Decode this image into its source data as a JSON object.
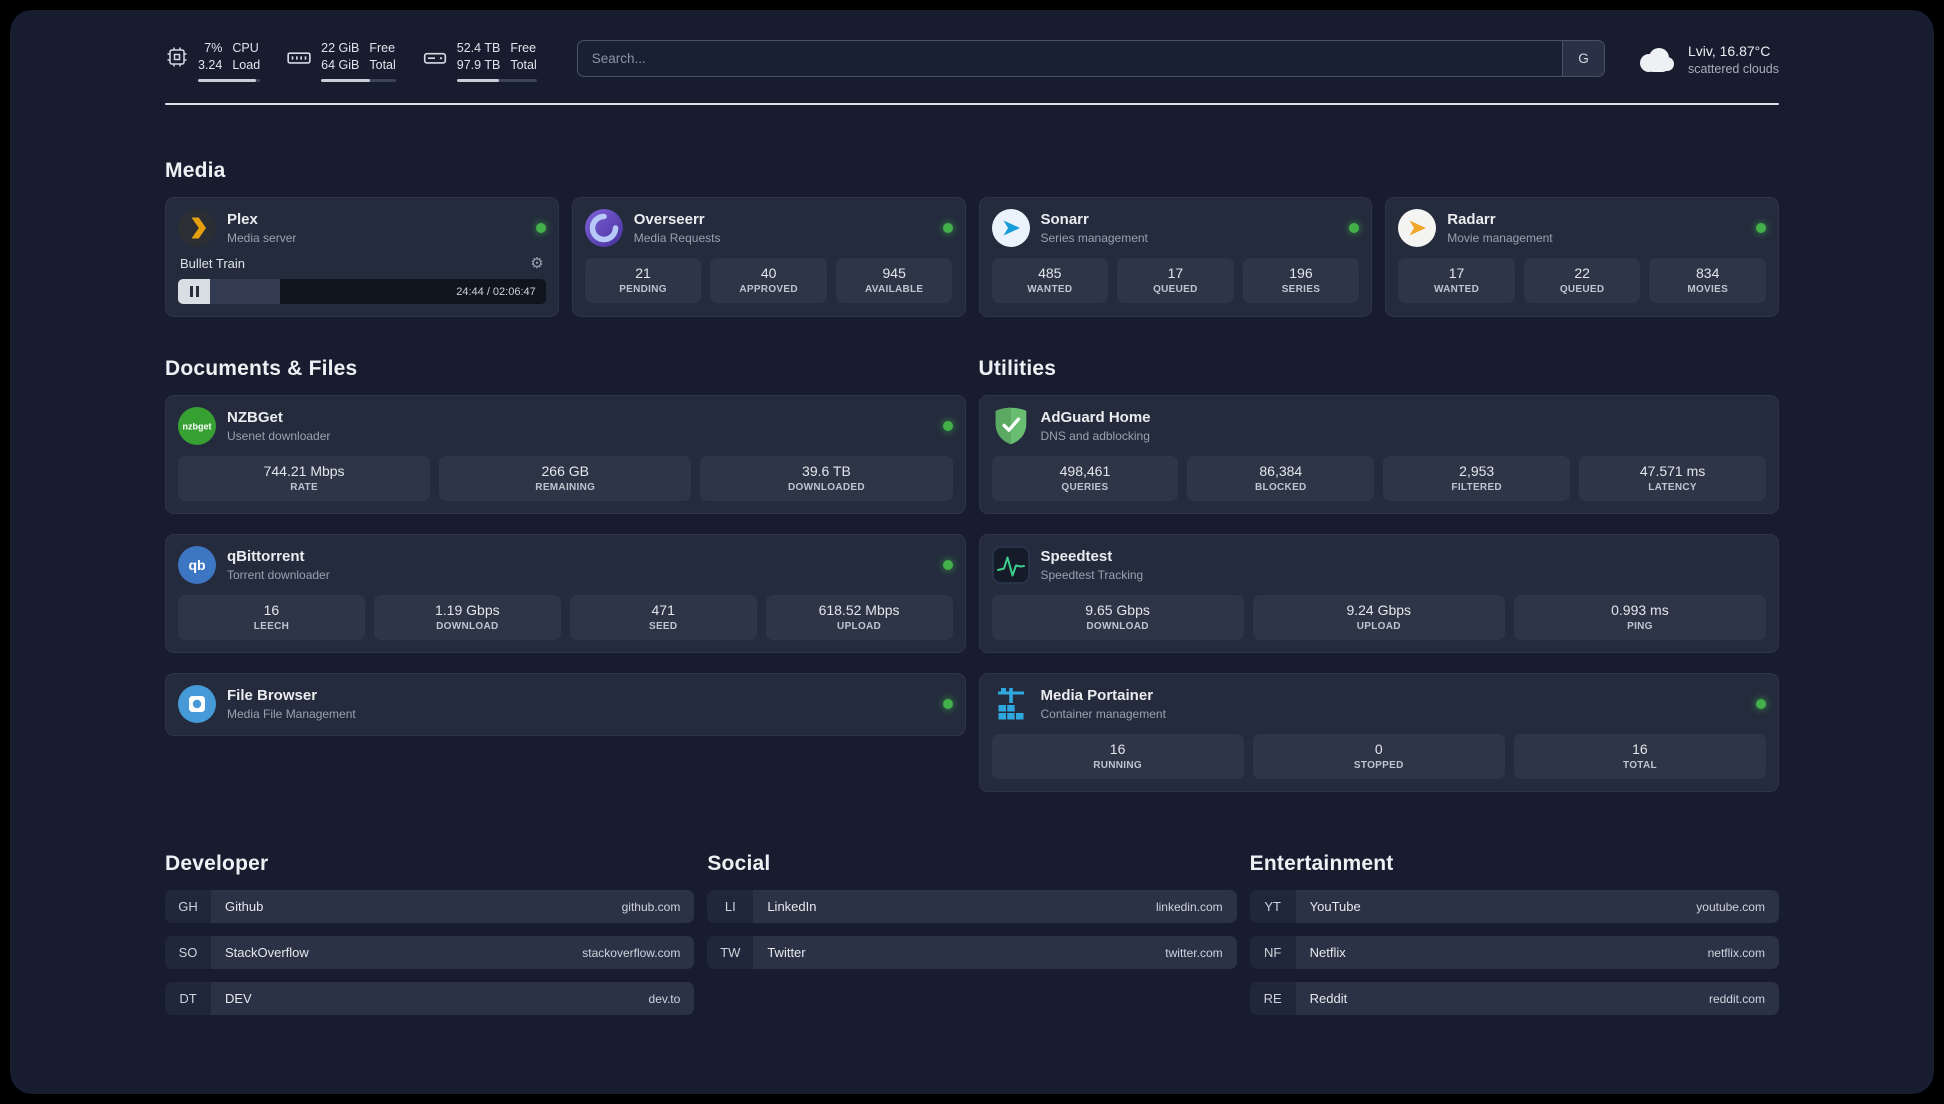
{
  "colors": {
    "status_green": "#43b04a",
    "page_background": "#171d2f",
    "card_background": "#242b3d",
    "stat_background": "#2e3547",
    "plex_gold": "#e5a00d",
    "sonarr_blue": "#159ddb",
    "radarr_amber": "#f0a72c",
    "adguard_green": "#68bd71",
    "portainer_blue": "#2fa8e0",
    "speedtest_line_green": "#3ecf8e"
  },
  "topbar": {
    "cpu": {
      "value_top": "7%",
      "value_bottom": "3.24",
      "label_top": "CPU",
      "label_bottom": "Load",
      "bar_percent": 93
    },
    "ram": {
      "value_top": "22 GiB",
      "value_bottom": "64 GiB",
      "label_top": "Free",
      "label_bottom": "Total",
      "bar_percent": 66
    },
    "disk": {
      "value_top": "52.4 TB",
      "value_bottom": "97.9 TB",
      "label_top": "Free",
      "label_bottom": "Total",
      "bar_percent": 53
    },
    "search": {
      "placeholder": "Search...",
      "engine_button": "G"
    },
    "weather": {
      "location": "Lviv, 16.87°C",
      "condition": "scattered clouds"
    }
  },
  "media": {
    "title": "Media",
    "plex": {
      "name": "Plex",
      "subtitle": "Media server",
      "now_playing": "Bullet Train",
      "time": "24:44 / 02:06:47",
      "progress_percent": 19
    },
    "overseerr": {
      "name": "Overseerr",
      "subtitle": "Media Requests",
      "stats": [
        {
          "value": "21",
          "label": "PENDING"
        },
        {
          "value": "40",
          "label": "APPROVED"
        },
        {
          "value": "945",
          "label": "AVAILABLE"
        }
      ]
    },
    "sonarr": {
      "name": "Sonarr",
      "subtitle": "Series management",
      "stats": [
        {
          "value": "485",
          "label": "WANTED"
        },
        {
          "value": "17",
          "label": "QUEUED"
        },
        {
          "value": "196",
          "label": "SERIES"
        }
      ]
    },
    "radarr": {
      "name": "Radarr",
      "subtitle": "Movie management",
      "stats": [
        {
          "value": "17",
          "label": "WANTED"
        },
        {
          "value": "22",
          "label": "QUEUED"
        },
        {
          "value": "834",
          "label": "MOVIES"
        }
      ]
    }
  },
  "documents": {
    "title": "Documents & Files",
    "nzbget": {
      "name": "NZBGet",
      "subtitle": "Usenet downloader",
      "stats": [
        {
          "value": "744.21 Mbps",
          "label": "RATE"
        },
        {
          "value": "266 GB",
          "label": "REMAINING"
        },
        {
          "value": "39.6 TB",
          "label": "DOWNLOADED"
        }
      ]
    },
    "qbittorrent": {
      "name": "qBittorrent",
      "subtitle": "Torrent downloader",
      "stats": [
        {
          "value": "16",
          "label": "LEECH"
        },
        {
          "value": "1.19 Gbps",
          "label": "DOWNLOAD"
        },
        {
          "value": "471",
          "label": "SEED"
        },
        {
          "value": "618.52 Mbps",
          "label": "UPLOAD"
        }
      ]
    },
    "filebrowser": {
      "name": "File Browser",
      "subtitle": "Media File Management"
    }
  },
  "utilities": {
    "title": "Utilities",
    "adguard": {
      "name": "AdGuard Home",
      "subtitle": "DNS and adblocking",
      "stats": [
        {
          "value": "498,461",
          "label": "QUERIES"
        },
        {
          "value": "86,384",
          "label": "BLOCKED"
        },
        {
          "value": "2,953",
          "label": "FILTERED"
        },
        {
          "value": "47.571 ms",
          "label": "LATENCY"
        }
      ]
    },
    "speedtest": {
      "name": "Speedtest",
      "subtitle": "Speedtest Tracking",
      "stats": [
        {
          "value": "9.65 Gbps",
          "label": "DOWNLOAD"
        },
        {
          "value": "9.24 Gbps",
          "label": "UPLOAD"
        },
        {
          "value": "0.993 ms",
          "label": "PING"
        }
      ]
    },
    "portainer": {
      "name": "Media Portainer",
      "subtitle": "Container management",
      "stats": [
        {
          "value": "16",
          "label": "RUNNING"
        },
        {
          "value": "0",
          "label": "STOPPED"
        },
        {
          "value": "16",
          "label": "TOTAL"
        }
      ]
    }
  },
  "bookmarks": {
    "developer": {
      "title": "Developer",
      "items": [
        {
          "abbr": "GH",
          "name": "Github",
          "url": "github.com"
        },
        {
          "abbr": "SO",
          "name": "StackOverflow",
          "url": "stackoverflow.com"
        },
        {
          "abbr": "DT",
          "name": "DEV",
          "url": "dev.to"
        }
      ]
    },
    "social": {
      "title": "Social",
      "items": [
        {
          "abbr": "LI",
          "name": "LinkedIn",
          "url": "linkedin.com"
        },
        {
          "abbr": "TW",
          "name": "Twitter",
          "url": "twitter.com"
        }
      ]
    },
    "entertainment": {
      "title": "Entertainment",
      "items": [
        {
          "abbr": "YT",
          "name": "YouTube",
          "url": "youtube.com"
        },
        {
          "abbr": "NF",
          "name": "Netflix",
          "url": "netflix.com"
        },
        {
          "abbr": "RE",
          "name": "Reddit",
          "url": "reddit.com"
        }
      ]
    }
  }
}
